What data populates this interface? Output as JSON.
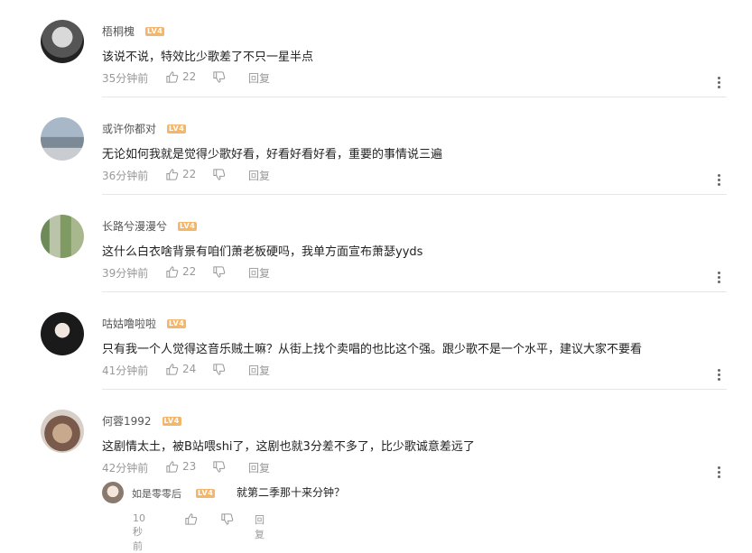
{
  "level_badge": "LV4",
  "comments": [
    {
      "user": "梧桐槐",
      "text": "该说不说，特效比少歌差了不只一星半点",
      "time": "35分钟前",
      "likes": "22",
      "reply_label": "回复"
    },
    {
      "user": "或许你都对",
      "text": "无论如何我就是觉得少歌好看，好看好看好看，重要的事情说三遍",
      "time": "36分钟前",
      "likes": "22",
      "reply_label": "回复"
    },
    {
      "user": "长路兮漫漫兮",
      "text": "这什么白衣啥背景有咱们萧老板硬吗，我单方面宣布萧瑟yyds",
      "time": "39分钟前",
      "likes": "22",
      "reply_label": "回复"
    },
    {
      "user": "咕姑噜啦啦",
      "text": "只有我一个人觉得这音乐贼土嘛？从街上找个卖唱的也比这个强。跟少歌不是一个水平，建议大家不要看",
      "time": "41分钟前",
      "likes": "24",
      "reply_label": "回复"
    },
    {
      "user": "何蓉1992",
      "text": "这剧情太土，被B站喂shi了，这剧也就3分差不多了，比少歌诚意差远了",
      "time": "42分钟前",
      "likes": "23",
      "reply_label": "回复"
    }
  ],
  "reply": {
    "user": "如是零零后",
    "text": "就第二季那十来分钟？",
    "time": "10秒前",
    "reply_label": "回复"
  },
  "colors": {
    "badge": "#f3b66d",
    "meta": "#999999",
    "divider": "#e6e6e6"
  }
}
